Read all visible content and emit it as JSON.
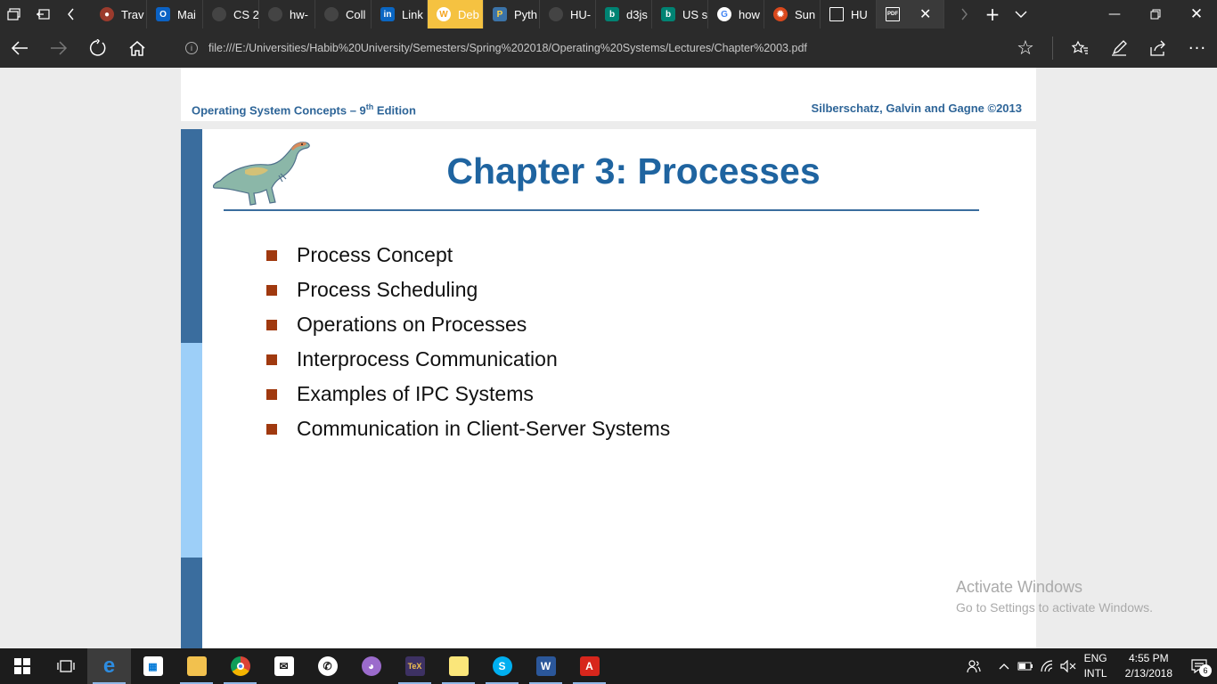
{
  "browser": {
    "tabs": [
      {
        "label": "Trav",
        "icon": "globe-icon",
        "color": "#9b3b2d"
      },
      {
        "label": "Mai",
        "icon": "outlook-icon",
        "color": "#0b62c4"
      },
      {
        "label": "CS 2",
        "icon": "github-icon",
        "color": "#444444"
      },
      {
        "label": "hw-",
        "icon": "github-icon",
        "color": "#444444"
      },
      {
        "label": "Coll",
        "icon": "github-icon",
        "color": "#444444"
      },
      {
        "label": "Link",
        "icon": "linkedin-icon",
        "color": "#0a66c2"
      },
      {
        "label": "Deb",
        "icon": "wordpress-icon",
        "color": "#f5c241"
      },
      {
        "label": "Pyth",
        "icon": "python-icon",
        "color": "#3b73a8"
      },
      {
        "label": "HU-",
        "icon": "github-icon",
        "color": "#444444"
      },
      {
        "label": "d3js",
        "icon": "bing-icon",
        "color": "#008373"
      },
      {
        "label": "US s",
        "icon": "bing-icon",
        "color": "#008373"
      },
      {
        "label": "how",
        "icon": "google-icon",
        "color": "#ffffff"
      },
      {
        "label": "Sun",
        "icon": "sun-icon",
        "color": "#d9481c"
      },
      {
        "label": "HU",
        "icon": "page-icon",
        "color": "#2b2b2b"
      }
    ],
    "current_tab_icon": "pdf-icon",
    "address": "file:///E:/Universities/Habib%20University/Semesters/Spring%202018/Operating%20Systems/Lectures/Chapter%2003.pdf"
  },
  "pdf": {
    "header_left_main": "Operating System Concepts – 9",
    "header_left_sup": "th",
    "header_left_tail": " Edition",
    "header_right": "Silberschatz, Galvin and Gagne ©2013",
    "title": "Chapter 3:  Processes",
    "bullets": [
      "Process Concept",
      "Process Scheduling",
      "Operations on Processes",
      "Interprocess Communication",
      "Examples of IPC Systems",
      "Communication in Client-Server Systems"
    ],
    "accent_color": "#1f64a0",
    "bullet_color": "#a0390f"
  },
  "watermark": {
    "title": "Activate Windows",
    "subtitle": "Go to Settings to activate Windows."
  },
  "taskbar": {
    "apps": [
      "start-icon",
      "task-view-icon",
      "edge-icon",
      "store-icon",
      "file-explorer-icon",
      "chrome-icon",
      "mail-icon",
      "whatsapp-icon",
      "github-desktop-icon",
      "texstudio-icon",
      "sticky-notes-icon",
      "skype-icon",
      "word-icon",
      "acrobat-icon"
    ],
    "lang_top": "ENG",
    "lang_bottom": "INTL",
    "time": "4:55 PM",
    "date": "2/13/2018",
    "notification_count": "6"
  }
}
